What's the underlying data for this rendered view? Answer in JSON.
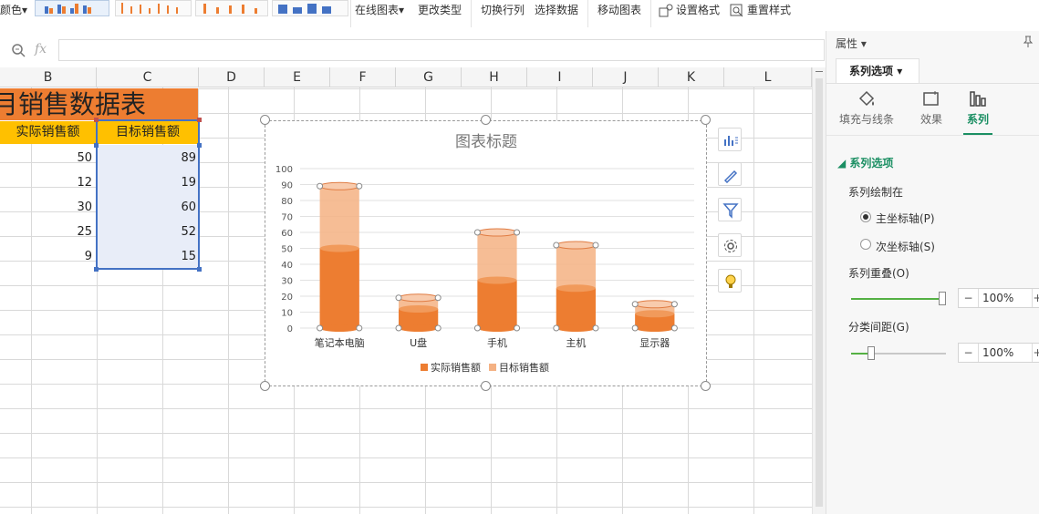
{
  "toolbar": {
    "color_label": "颜色",
    "online_chart": "在线图表",
    "change_type": "更改类型",
    "switch_row_col": "切换行列",
    "select_data": "选择数据",
    "move_chart": "移动图表",
    "set_format": "设置格式",
    "reset_style": "重置样式"
  },
  "formula_bar": {
    "fx": "fx",
    "value": ""
  },
  "columns": [
    "B",
    "C",
    "D",
    "E",
    "F",
    "G",
    "H",
    "I",
    "J",
    "K",
    "L"
  ],
  "sheet": {
    "title": "月销售数据表",
    "headers": [
      "实际销售额",
      "目标销售额"
    ],
    "rows": [
      {
        "actual": "50",
        "target": "89"
      },
      {
        "actual": "12",
        "target": "19"
      },
      {
        "actual": "30",
        "target": "60"
      },
      {
        "actual": "25",
        "target": "52"
      },
      {
        "actual": "9",
        "target": "15"
      }
    ]
  },
  "chart_data": {
    "type": "bar",
    "title": "图表标题",
    "categories": [
      "笔记本电脑",
      "U盘",
      "手机",
      "主机",
      "显示器"
    ],
    "series": [
      {
        "name": "实际销售额",
        "values": [
          50,
          12,
          30,
          25,
          9
        ],
        "color": "#ed7d31"
      },
      {
        "name": "目标销售额",
        "values": [
          89,
          19,
          60,
          52,
          15
        ],
        "color": "#f4b183"
      }
    ],
    "ylim": [
      0,
      100
    ],
    "yticks": [
      0,
      10,
      20,
      30,
      40,
      50,
      60,
      70,
      80,
      90,
      100
    ],
    "grid": true,
    "overlap": "100%",
    "legend": "bottom"
  },
  "panel": {
    "title": "属性",
    "series_options_tab": "系列选项",
    "tabs": [
      {
        "label": "填充与线条",
        "icon": "fill-bucket-icon"
      },
      {
        "label": "效果",
        "icon": "effects-icon"
      },
      {
        "label": "系列",
        "icon": "series-icon"
      }
    ],
    "section_title": "系列选项",
    "plot_on": "系列绘制在",
    "primary_axis": "主坐标轴(P)",
    "secondary_axis": "次坐标轴(S)",
    "overlap_label": "系列重叠(O)",
    "overlap_value": "100%",
    "gap_label": "分类间距(G)",
    "gap_value": "100%"
  }
}
